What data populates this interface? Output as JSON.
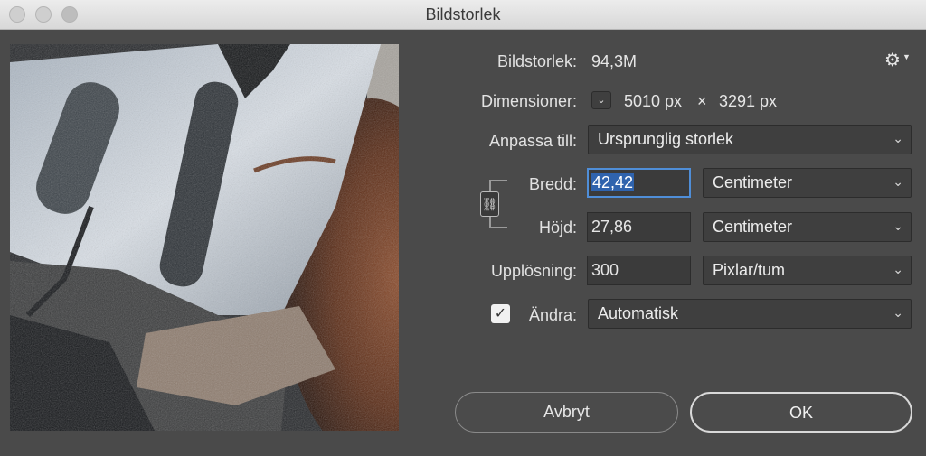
{
  "window": {
    "title": "Bildstorlek"
  },
  "image_size": {
    "label": "Bildstorlek:",
    "value": "94,3M"
  },
  "dimensions": {
    "label": "Dimensioner:",
    "width": "5010 px",
    "times": "×",
    "height": "3291 px"
  },
  "fit_to": {
    "label": "Anpassa till:",
    "value": "Ursprunglig storlek"
  },
  "width": {
    "label": "Bredd:",
    "value": "42,42",
    "unit": "Centimeter"
  },
  "height": {
    "label": "Höjd:",
    "value": "27,86",
    "unit": "Centimeter"
  },
  "resolution": {
    "label": "Upplösning:",
    "value": "300",
    "unit": "Pixlar/tum"
  },
  "resample": {
    "label": "Ändra:",
    "value": "Automatisk",
    "checked": true
  },
  "buttons": {
    "cancel": "Avbryt",
    "ok": "OK"
  },
  "colors": {
    "focus": "#4f8ed8",
    "selection": "#2f63ad",
    "dialog_bg": "#4a4a4a"
  }
}
